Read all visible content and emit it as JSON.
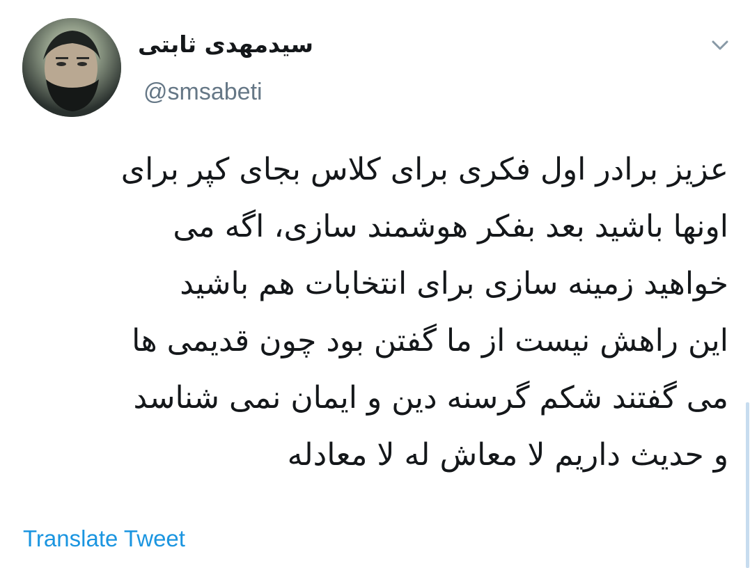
{
  "tweet": {
    "author": {
      "display_name": "سیدمهدی ثابتی",
      "handle": "@smsabeti",
      "avatar_icon": "profile-photo"
    },
    "menu_icon": "chevron-down-icon",
    "text_lines": [
      "عزیز برادر اول فکری برای کلاس بجای کپر برای",
      "اونها باشید بعد بفکر هوشمند سازی،  اگه می",
      "خواهید زمینه سازی برای انتخابات هم باشید",
      "این راهش نیست از ما گفتن بود چون قدیمی ها",
      "می گفتند شکم گرسنه دین و ایمان نمی شناسد",
      "و حدیث داریم لا معاش له لا معادله"
    ],
    "translate_label": "Translate Tweet"
  },
  "colors": {
    "text": "#14171a",
    "secondary": "#657786",
    "link": "#1b95e0",
    "scrollbar": "#c7dcef"
  }
}
